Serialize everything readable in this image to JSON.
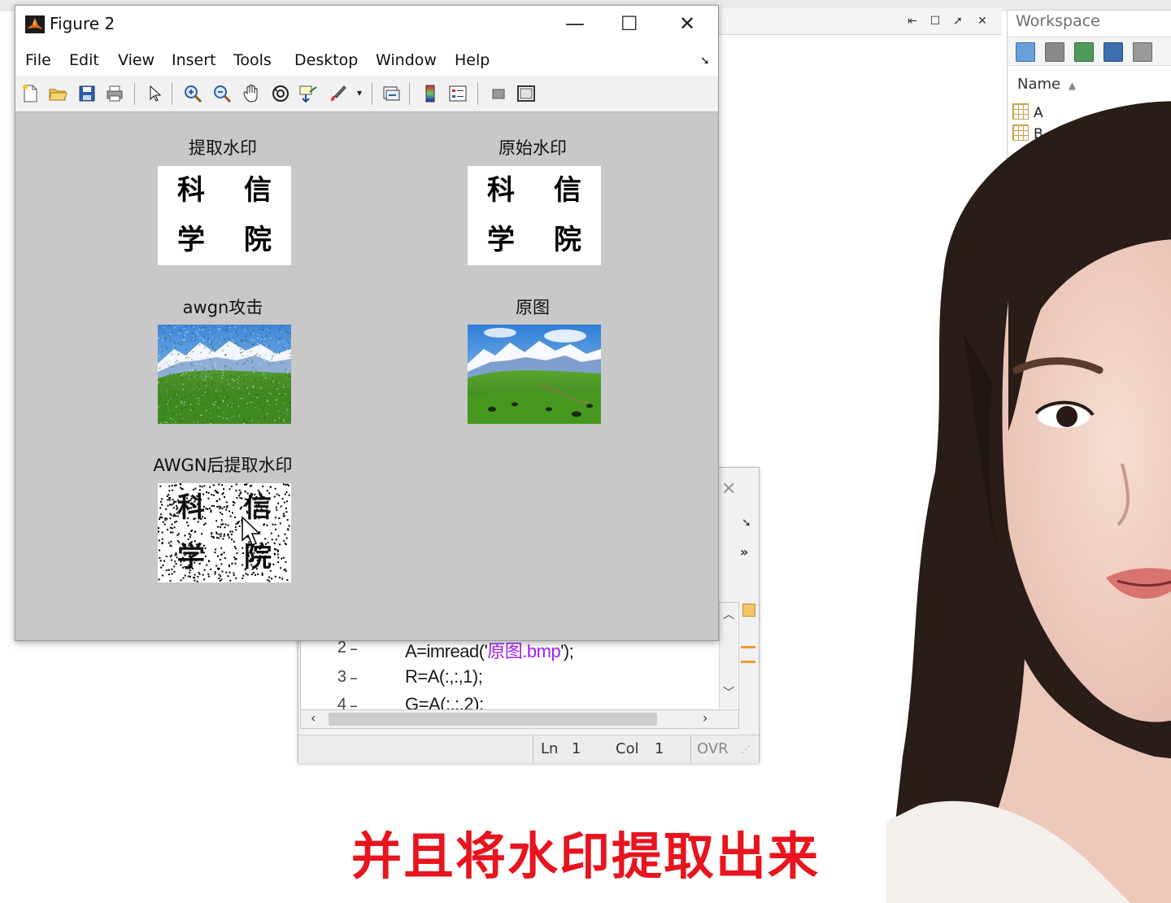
{
  "figure": {
    "title": "Figure 2",
    "menu": [
      "File",
      "Edit",
      "View",
      "Insert",
      "Tools",
      "Desktop",
      "Window",
      "Help"
    ],
    "subplots": [
      {
        "title": "提取水印",
        "chars": [
          "科",
          "信",
          "学",
          "院"
        ]
      },
      {
        "title": "原始水印",
        "chars": [
          "科",
          "信",
          "学",
          "院"
        ]
      },
      {
        "title": "awgn攻击"
      },
      {
        "title": "原图"
      },
      {
        "title": "AWGN后提取水印",
        "chars": [
          "科",
          "信",
          "学",
          "院"
        ]
      }
    ]
  },
  "workspace": {
    "title": "Workspace",
    "name_header": "Name",
    "variables": [
      "A",
      "B"
    ]
  },
  "editor": {
    "lines": [
      {
        "num": "2",
        "pre": "A=imread('",
        "str": "原图.bmp",
        "post": "');"
      },
      {
        "num": "3",
        "pre": "R=A(:,:,1);",
        "str": "",
        "post": ""
      },
      {
        "num": "4",
        "pre": "G=A(:,:,2);",
        "str": "",
        "post": ""
      }
    ],
    "status": {
      "ln_label": "Ln",
      "ln": "1",
      "col_label": "Col",
      "col": "1",
      "ovr": "OVR"
    }
  },
  "caption": "并且将水印提取出来",
  "colors": {
    "caption": "#e8141e",
    "string": "#a020f0",
    "figure_bg": "#c8c8c8"
  }
}
